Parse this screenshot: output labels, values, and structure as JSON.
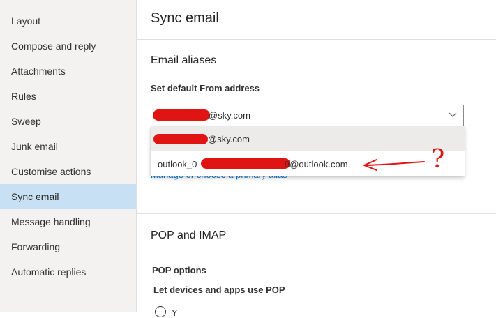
{
  "sidebar": {
    "items": [
      {
        "label": "Layout"
      },
      {
        "label": "Compose and reply"
      },
      {
        "label": "Attachments"
      },
      {
        "label": "Rules"
      },
      {
        "label": "Sweep"
      },
      {
        "label": "Junk email"
      },
      {
        "label": "Customise actions"
      },
      {
        "label": "Sync email",
        "selected": true
      },
      {
        "label": "Message handling"
      },
      {
        "label": "Forwarding"
      },
      {
        "label": "Automatic replies"
      }
    ]
  },
  "page": {
    "title": "Sync email"
  },
  "aliases": {
    "title": "Email aliases",
    "default_from_label": "Set default From address",
    "selected_value_suffix": "@sky.com",
    "options": [
      {
        "prefix": "",
        "suffix": "@sky.com"
      },
      {
        "prefix": "outlook_0",
        "suffix": "9@outlook.com"
      }
    ],
    "manage_link": "Manage or choose a primary alias"
  },
  "pop_imap": {
    "title": "POP and IMAP",
    "pop_options_label": "POP options",
    "let_devices_label": "Let devices and apps use POP",
    "radio_label": "Y"
  },
  "annotation": {
    "color": "#e11414",
    "mark": "?"
  },
  "colors": {
    "sidebar_bg": "#f3f2f1",
    "selected_bg": "#c7e0f4",
    "link": "#0078d4",
    "redaction": "#e11414"
  }
}
